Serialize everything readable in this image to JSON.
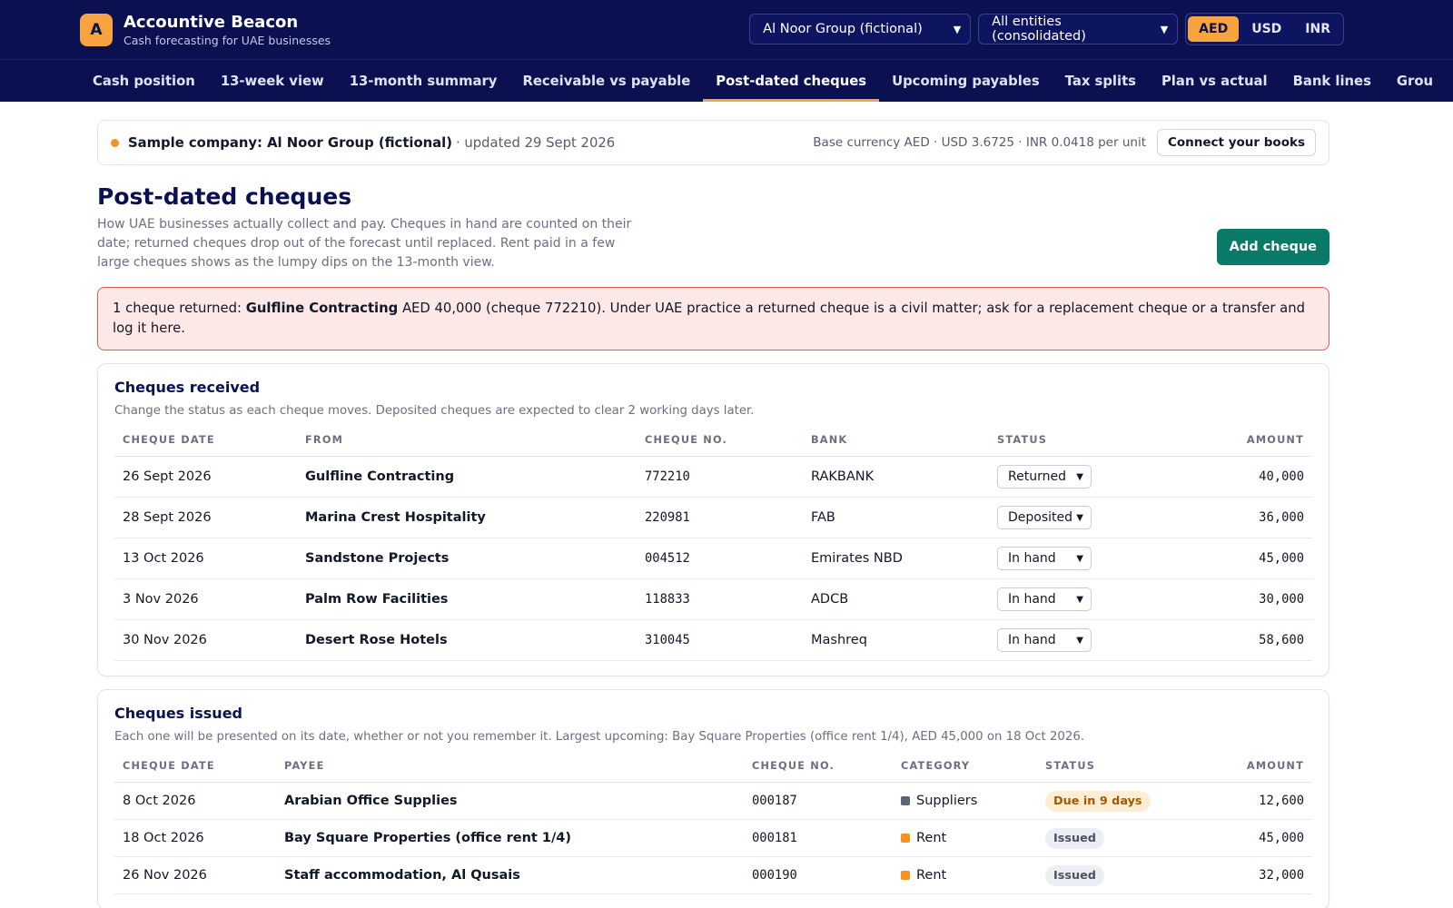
{
  "app": {
    "logo_letter": "A",
    "name": "Accountive Beacon",
    "tagline": "Cash forecasting for UAE businesses"
  },
  "header": {
    "company_select": "Al Noor Group (fictional)",
    "entity_select": "All entities (consolidated)",
    "currencies": [
      "AED",
      "USD",
      "INR"
    ],
    "active_currency": "AED"
  },
  "nav": {
    "items": [
      "Cash position",
      "13-week view",
      "13-month summary",
      "Receivable vs payable",
      "Post-dated cheques",
      "Upcoming payables",
      "Tax splits",
      "Plan vs actual",
      "Bank lines",
      "Grou"
    ],
    "active": "Post-dated cheques"
  },
  "banner": {
    "company": "Sample company: Al Noor Group (fictional)",
    "updated": "· updated 29 Sept 2026",
    "rates": "Base currency AED · USD 3.6725 · INR 0.0418 per unit",
    "connect_label": "Connect your books"
  },
  "page": {
    "title": "Post-dated cheques",
    "description": "How UAE businesses actually collect and pay. Cheques in hand are counted on their date; returned cheques drop out of the forecast until replaced. Rent paid in a few large cheques shows as the lumpy dips on the 13-month view.",
    "add_label": "Add cheque"
  },
  "alert": {
    "prefix": "1 cheque returned: ",
    "name": "Gulfline Contracting",
    "rest": " AED 40,000 (cheque 772210). Under UAE practice a returned cheque is a civil matter; ask for a replacement cheque or a transfer and log it here."
  },
  "received": {
    "title": "Cheques received",
    "subtitle": "Change the status as each cheque moves. Deposited cheques are expected to clear 2 working days later.",
    "headers": [
      "CHEQUE DATE",
      "FROM",
      "CHEQUE NO.",
      "BANK",
      "STATUS",
      "AMOUNT"
    ],
    "rows": [
      {
        "date": "26 Sept 2026",
        "from": "Gulfline Contracting",
        "no": "772210",
        "bank": "RAKBANK",
        "status": "Returned",
        "amount": "40,000"
      },
      {
        "date": "28 Sept 2026",
        "from": "Marina Crest Hospitality",
        "no": "220981",
        "bank": "FAB",
        "status": "Deposited",
        "amount": "36,000"
      },
      {
        "date": "13 Oct 2026",
        "from": "Sandstone Projects",
        "no": "004512",
        "bank": "Emirates NBD",
        "status": "In hand",
        "amount": "45,000"
      },
      {
        "date": "3 Nov 2026",
        "from": "Palm Row Facilities",
        "no": "118833",
        "bank": "ADCB",
        "status": "In hand",
        "amount": "30,000"
      },
      {
        "date": "30 Nov 2026",
        "from": "Desert Rose Hotels",
        "no": "310045",
        "bank": "Mashreq",
        "status": "In hand",
        "amount": "58,600"
      }
    ]
  },
  "issued": {
    "title": "Cheques issued",
    "subtitle": "Each one will be presented on its date, whether or not you remember it. Largest upcoming: Bay Square Properties (office rent 1/4), AED 45,000 on 18 Oct 2026.",
    "headers": [
      "CHEQUE DATE",
      "PAYEE",
      "CHEQUE NO.",
      "CATEGORY",
      "STATUS",
      "AMOUNT"
    ],
    "rows": [
      {
        "date": "8 Oct 2026",
        "payee": "Arabian Office Supplies",
        "no": "000187",
        "category": "Suppliers",
        "category_color": "#5b6478",
        "status": "Due in 9 days",
        "status_kind": "due",
        "amount": "12,600"
      },
      {
        "date": "18 Oct 2026",
        "payee": "Bay Square Properties (office rent 1/4)",
        "no": "000181",
        "category": "Rent",
        "category_color": "#f7931e",
        "status": "Issued",
        "status_kind": "issued",
        "amount": "45,000"
      },
      {
        "date": "26 Nov 2026",
        "payee": "Staff accommodation, Al Qusais",
        "no": "000190",
        "category": "Rent",
        "category_color": "#f7931e",
        "status": "Issued",
        "status_kind": "issued",
        "amount": "32,000"
      }
    ]
  }
}
